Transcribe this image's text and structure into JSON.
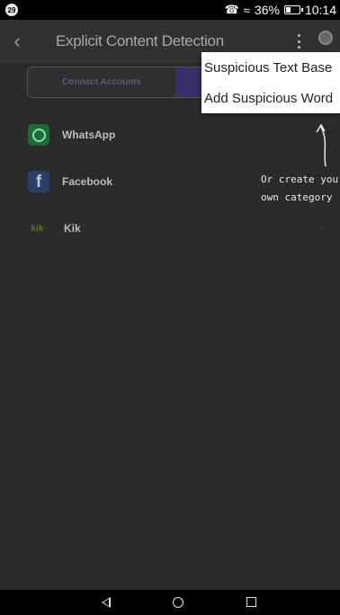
{
  "status_bar": {
    "notification_count": "29",
    "call_icon": "phone-icon",
    "wifi_icon": "wifi-icon",
    "battery_percent": "36%",
    "battery_level": 0.36,
    "time": "10:14"
  },
  "app_bar": {
    "title": "Explicit Content Detection",
    "back_icon": "back-arrow-icon",
    "menu_icon": "more-vert-icon"
  },
  "tabs": [
    {
      "label": "Connect Accounts",
      "active": false
    },
    {
      "label": "",
      "active": true
    }
  ],
  "apps": [
    {
      "name": "WhatsApp",
      "icon": "whatsapp-icon",
      "color": "#1d6b3a"
    },
    {
      "name": "Facebook",
      "icon": "facebook-icon",
      "color": "#2c3f6a"
    },
    {
      "name": "Kik",
      "icon": "kik-icon",
      "logo_text": "kik·",
      "color": "#4a7a2a"
    }
  ],
  "hint": {
    "line1": "Or create you",
    "line2": "own category"
  },
  "dropdown": {
    "items": [
      "Suspicious Text Base",
      "Add Suspicious Word"
    ]
  },
  "nav_bar": {
    "back_icon": "nav-back-icon",
    "home_icon": "nav-home-icon",
    "recent_icon": "nav-recent-icon"
  },
  "colors": {
    "accent": "#3a2e6b",
    "background": "#2b2b2b",
    "menu_background": "#ffffff"
  }
}
